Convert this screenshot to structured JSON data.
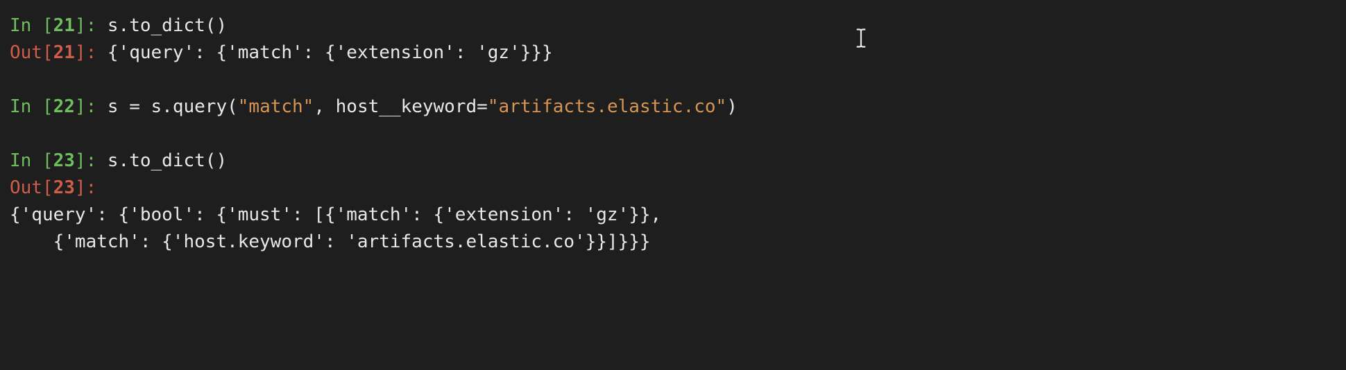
{
  "cells": {
    "c21": {
      "in_prefix": "In [",
      "in_num": "21",
      "in_suffix": "]: ",
      "in_code": "s.to_dict()",
      "out_prefix": "Out[",
      "out_num": "21",
      "out_suffix": "]: ",
      "out_code": "{'query': {'match': {'extension': 'gz'}}}"
    },
    "c22": {
      "in_prefix": "In [",
      "in_num": "22",
      "in_suffix": "]: ",
      "code_a": "s ",
      "code_eq": "=",
      "code_b": " s.query(",
      "str1": "\"match\"",
      "code_c": ", host__keyword",
      "code_eq2": "=",
      "str2": "\"artifacts.elastic.co\"",
      "code_d": ")"
    },
    "c23": {
      "in_prefix": "In [",
      "in_num": "23",
      "in_suffix": "]: ",
      "in_code": "s.to_dict()",
      "out_prefix": "Out[",
      "out_num": "23",
      "out_suffix": "]:",
      "out_line1": "{'query': {'bool': {'must': [{'match': {'extension': 'gz'}},",
      "out_line2": "    {'match': {'host.keyword': 'artifacts.elastic.co'}}]}}}"
    }
  },
  "cursor_name": "text-cursor-icon"
}
